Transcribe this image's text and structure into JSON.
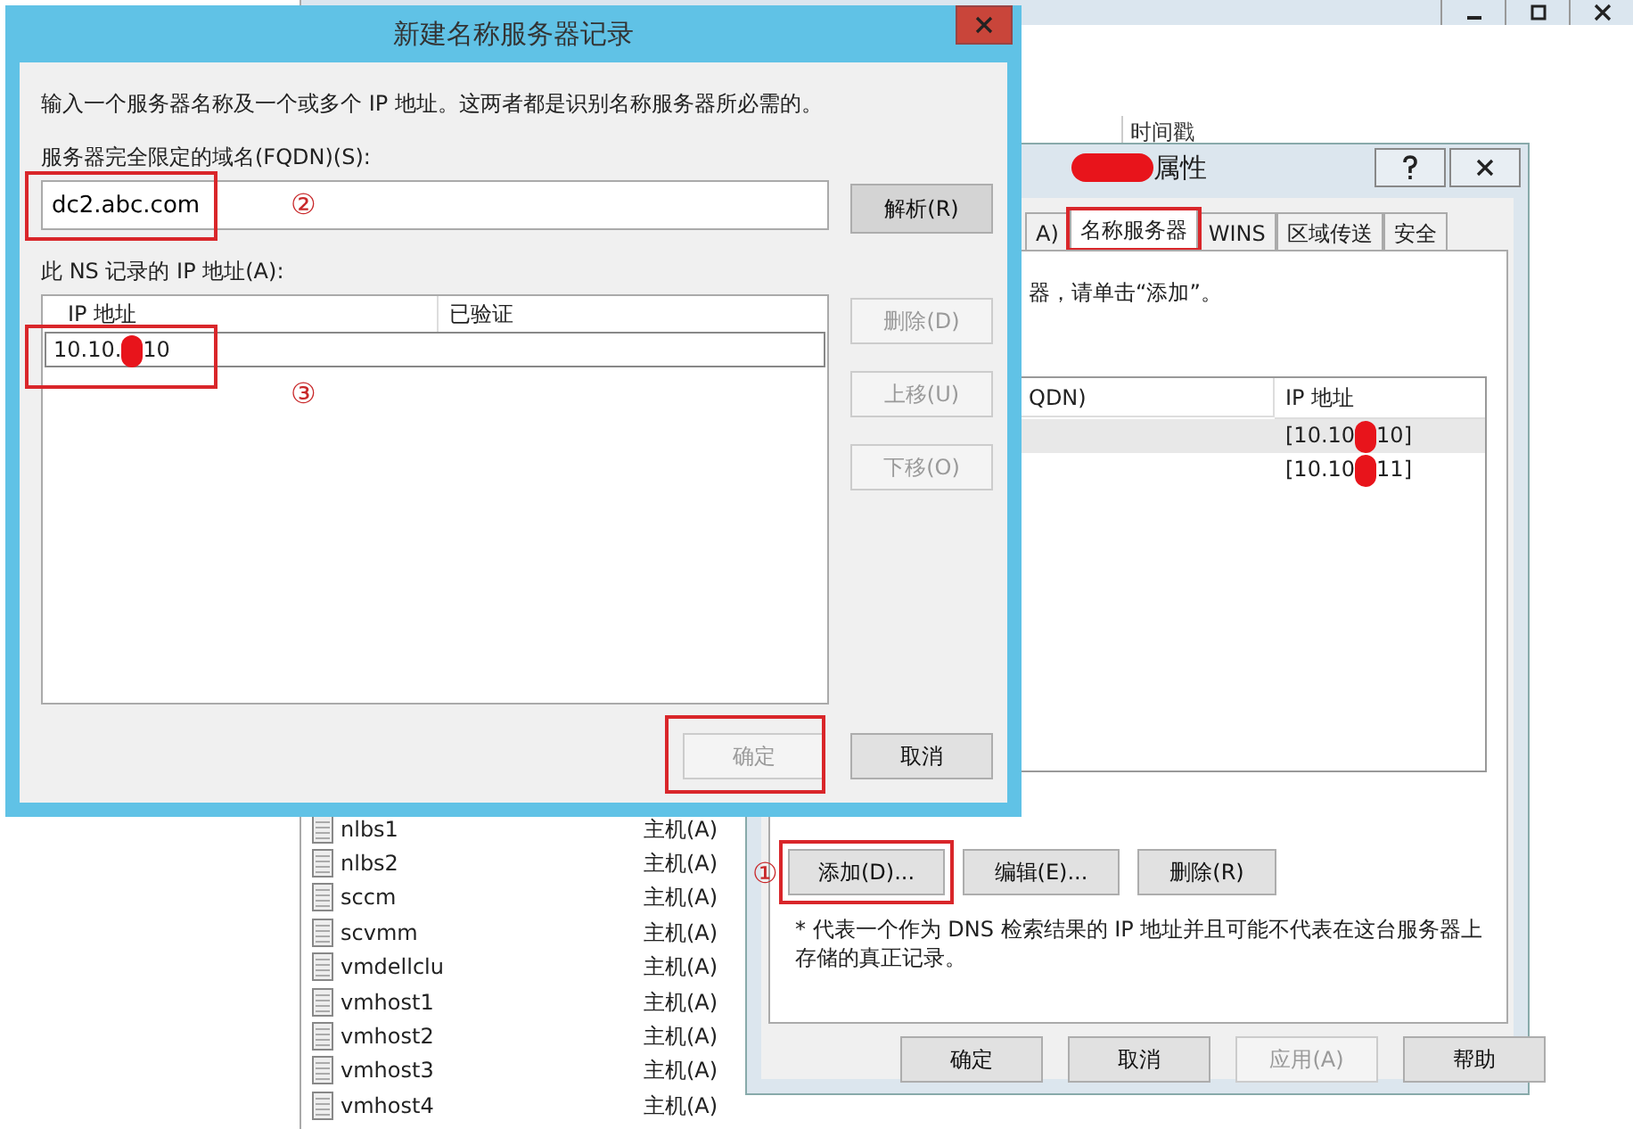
{
  "background_window": {
    "column_header": "时间戳",
    "records": [
      {
        "name": "nlbs1",
        "type": "主机(A)"
      },
      {
        "name": "nlbs2",
        "type": "主机(A)"
      },
      {
        "name": "sccm",
        "type": "主机(A)"
      },
      {
        "name": "scvmm",
        "type": "主机(A)"
      },
      {
        "name": "vmdellclu",
        "type": "主机(A)"
      },
      {
        "name": "vmhost1",
        "type": "主机(A)"
      },
      {
        "name": "vmhost2",
        "type": "主机(A)"
      },
      {
        "name": "vmhost3",
        "type": "主机(A)"
      },
      {
        "name": "vmhost4",
        "type": "主机(A)"
      }
    ]
  },
  "properties_dialog": {
    "title": "属性",
    "tabs": [
      {
        "label": "A)",
        "selected": false
      },
      {
        "label": "名称服务器",
        "selected": true
      },
      {
        "label": "WINS",
        "selected": false
      },
      {
        "label": "区域传送",
        "selected": false
      },
      {
        "label": "安全",
        "selected": false
      }
    ],
    "instruction": "器，请单击“添加”。",
    "columns": [
      "QDN)",
      "IP 地址"
    ],
    "servers": [
      {
        "ip_start": "[10.10",
        "ip_end": "10]",
        "selected": true
      },
      {
        "ip_start": "[10.10",
        "ip_end": "11]",
        "selected": false
      }
    ],
    "actions": [
      {
        "label": "添加(D)...",
        "highlighted": true
      },
      {
        "label": "编辑(E)...",
        "highlighted": false
      },
      {
        "label": "删除(R)",
        "highlighted": false
      }
    ],
    "callout": "①",
    "note": "* 代表一个作为 DNS 检索结果的 IP 地址并且可能不代表在这台服务器上存储的真正记录。",
    "buttons": [
      {
        "label": "确定",
        "disabled": false
      },
      {
        "label": "取消",
        "disabled": false
      },
      {
        "label": "应用(A)",
        "disabled": true
      },
      {
        "label": "帮助",
        "disabled": false
      }
    ]
  },
  "new_record_dialog": {
    "title": "新建名称服务器记录",
    "intro": "输入一个服务器名称及一个或多个 IP 地址。这两者都是识别名称服务器所必需的。",
    "fqdn_label": "服务器完全限定的域名(FQDN)(S):",
    "fqdn_value": "dc2.abc.com",
    "fqdn_callout": "②",
    "resolve_button": "解析(R)",
    "ip_label": "此 NS 记录的 IP 地址(A):",
    "ip_columns": [
      "IP 地址",
      "已验证"
    ],
    "ip_entry_start": "10.10.",
    "ip_entry_end": "10",
    "ip_callout": "③",
    "side_buttons": [
      {
        "label": "删除(D)",
        "disabled": true
      },
      {
        "label": "上移(U)",
        "disabled": true
      },
      {
        "label": "下移(O)",
        "disabled": true
      }
    ],
    "buttons": [
      {
        "label": "确定",
        "disabled": true,
        "highlighted": true
      },
      {
        "label": "取消",
        "disabled": false,
        "highlighted": false
      }
    ]
  }
}
